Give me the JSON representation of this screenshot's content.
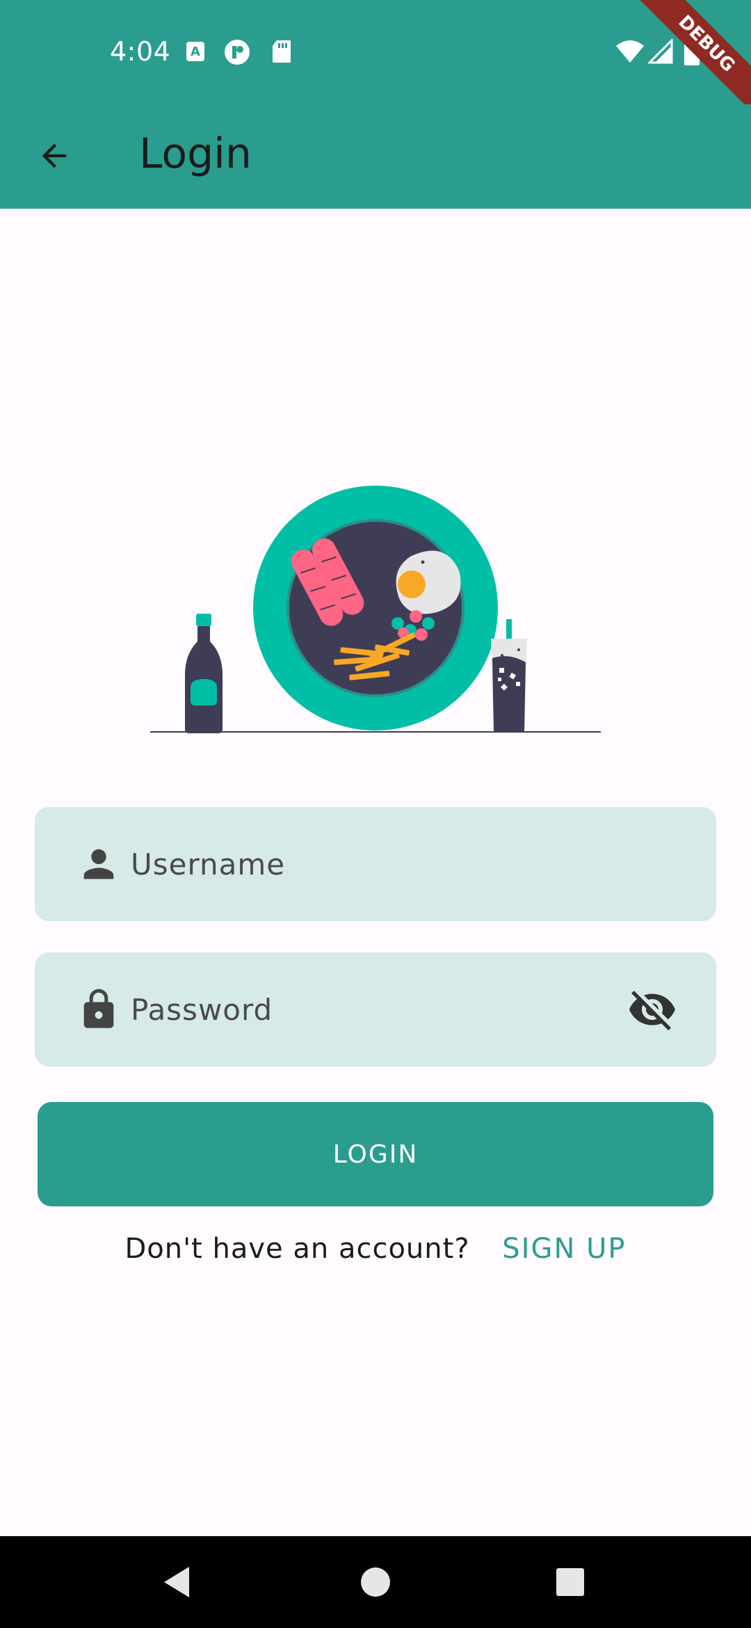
{
  "status_bar": {
    "time": "4:04",
    "debug_label": "DEBUG",
    "icons": [
      "a-notification-icon",
      "p-notification-icon",
      "sd-card-icon",
      "wifi-icon",
      "signal-icon",
      "battery-icon"
    ]
  },
  "app_bar": {
    "title": "Login",
    "back_icon": "arrow-back-icon"
  },
  "form": {
    "username_placeholder": "Username",
    "password_placeholder": "Password",
    "username_icon": "person-icon",
    "password_icon": "lock-icon",
    "visibility_icon": "visibility-off-icon"
  },
  "login_button": {
    "label": "LOGIN"
  },
  "signup": {
    "prompt": "Don't have an account?",
    "link": "SIGN UP"
  },
  "colors": {
    "primary": "#2a9d8f",
    "field_bg": "#d6eae8",
    "plate": "#00bfa6",
    "dark": "#3f3d56",
    "sausage": "#ff6584",
    "egg_yolk": "#f9a826"
  },
  "nav_bar": {
    "icons": [
      "back-triangle-icon",
      "home-circle-icon",
      "recents-square-icon"
    ]
  }
}
